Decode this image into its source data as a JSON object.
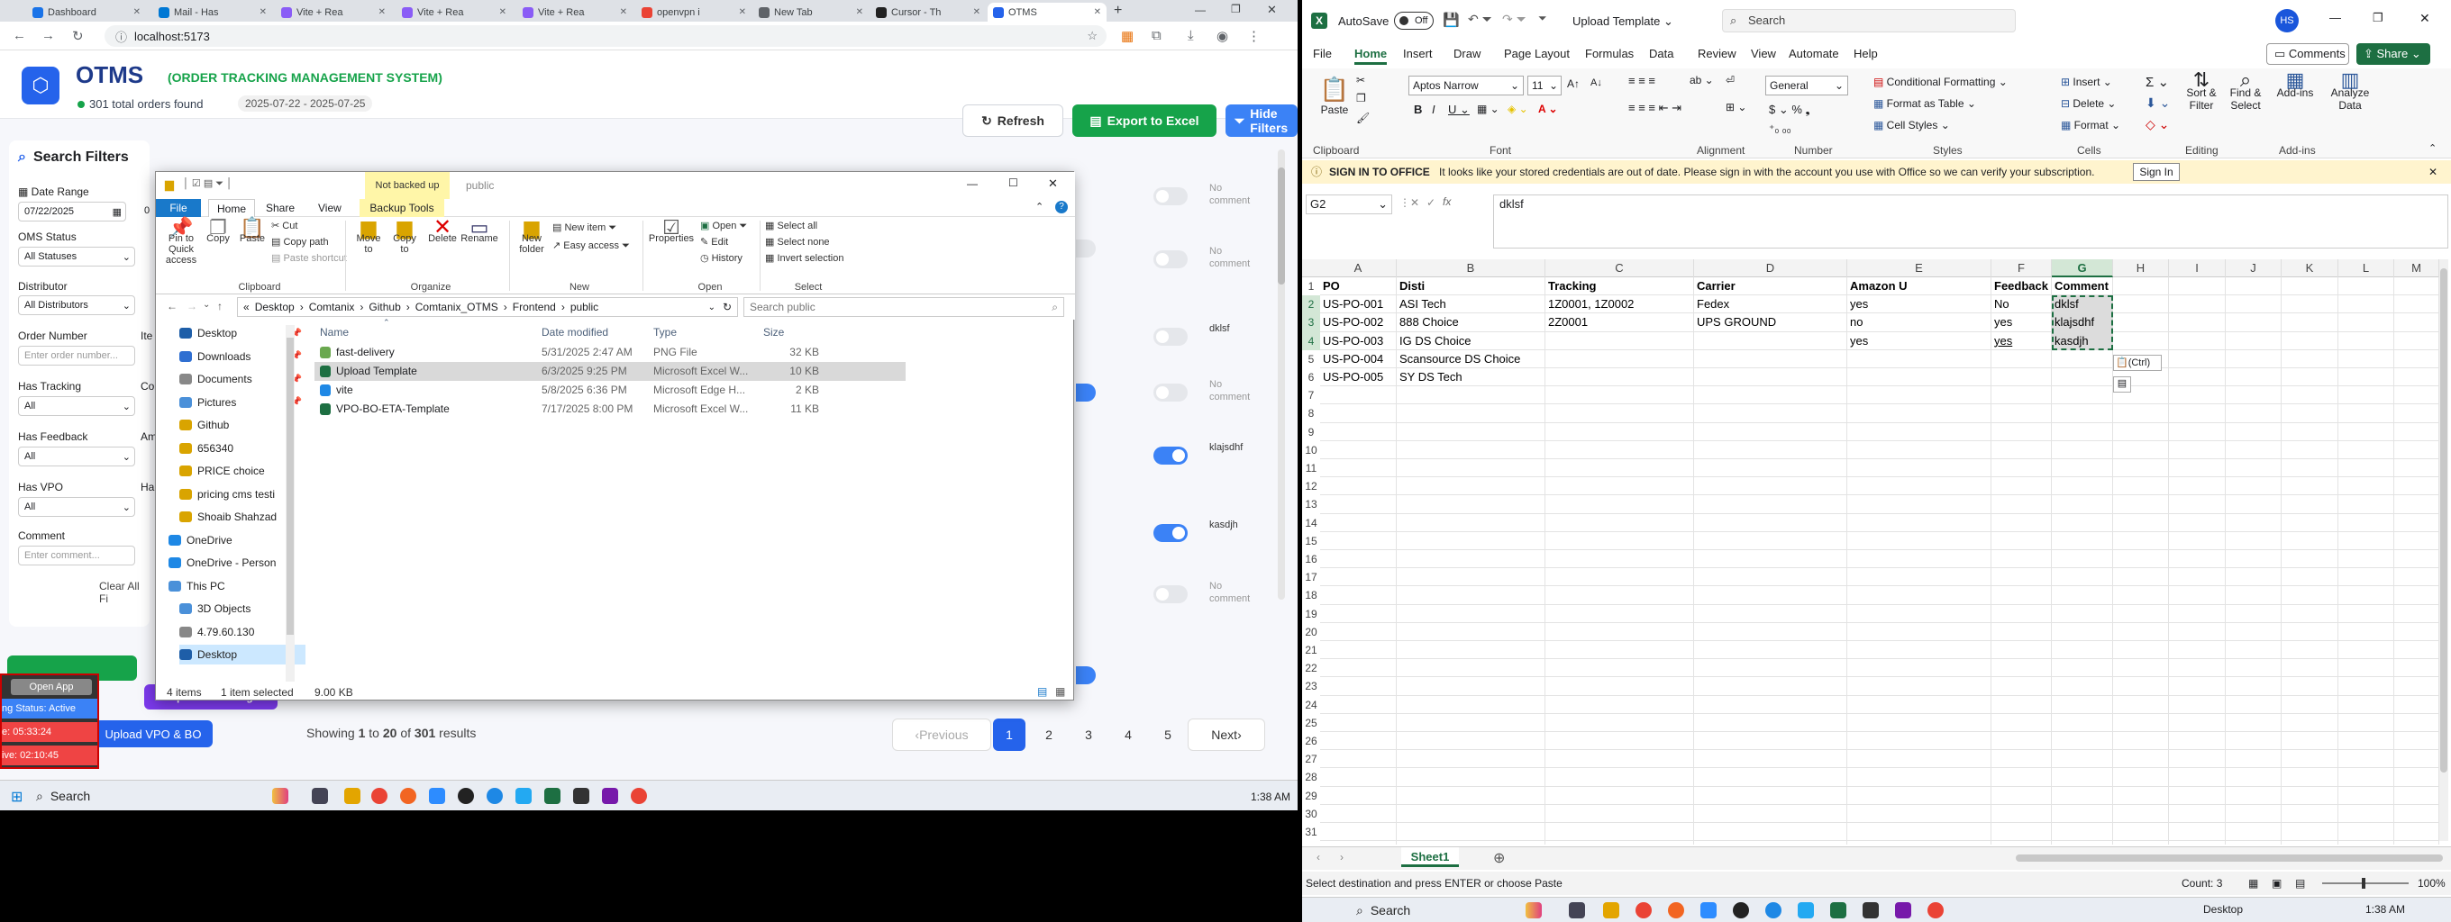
{
  "browser": {
    "tabs": [
      "Dashboard",
      "Mail - Has",
      "Vite + Rea",
      "Vite + Rea",
      "Vite + Rea",
      "openvpn i",
      "New Tab",
      "Cursor - Th",
      "OTMS"
    ],
    "url": "localhost:5173"
  },
  "otms": {
    "title": "OTMS",
    "subtitle": "(ORDER TRACKING MANAGEMENT SYSTEM)",
    "total": "301 total orders found",
    "date_range": "2025-07-22 - 2025-07-25",
    "refresh": "Refresh",
    "export": "Export to Excel",
    "hide": "Hide Filters",
    "filters_title": "Search Filters",
    "date_label": "Date Range",
    "date_value": "07/22/2025",
    "date_value2": "0",
    "status_label": "OMS Status",
    "status_value": "All Statuses",
    "dist_label": "Distributor",
    "dist_value": "All Distributors",
    "order_label": "Order Number",
    "order_ph": "Enter order number...",
    "iter_label": "Ite",
    "track_label": "Has Tracking",
    "track_value": "All",
    "co_label": "Co",
    "feedback_label": "Has Feedback",
    "feedback_value": "All",
    "am_label": "Am",
    "vpo_label": "Has VPO",
    "vpo_value": "All",
    "ha_label": "Ha",
    "comment_label": "Comment",
    "comment_ph": "Enter comment...",
    "clear": "Clear All Fi",
    "open_app": "Open App",
    "upload_tracking": "Upload Tracking",
    "upload_vpo": "Upload VPO & BO",
    "status_active": "ng Status: Active",
    "timer1": "e: 05:33:24",
    "timer2": "ive: 02:10:45",
    "rows": [
      {
        "on": false,
        "comment": "No comment"
      },
      {
        "on": false,
        "comment": "No comment"
      },
      {
        "on": false,
        "comment": "dklsf"
      },
      {
        "on": false,
        "comment": "No comment"
      },
      {
        "on": true,
        "comment": "klajsdhf"
      },
      {
        "on": true,
        "comment": "kasdjh"
      },
      {
        "on": false,
        "comment": "No comment"
      }
    ],
    "showing_pre": "Showing",
    "showing_from": "1",
    "showing_to_word": "to",
    "showing_to": "20",
    "showing_of": "of",
    "showing_total": "301",
    "showing_suffix": "results",
    "prev": "Previous",
    "next": "Next",
    "pages": [
      "1",
      "2",
      "3",
      "4",
      "5"
    ]
  },
  "explorer": {
    "title": "public",
    "backup_badge": "Not backed up",
    "tabs": [
      "File",
      "Home",
      "Share",
      "View",
      "Backup Tools"
    ],
    "ribbon": {
      "pin": "Pin to Quick access",
      "copy": "Copy",
      "paste": "Paste",
      "cut": "Cut",
      "copy_path": "Copy path",
      "paste_shortcut": "Paste shortcut",
      "move_to": "Move to",
      "copy_to": "Copy to",
      "delete": "Delete",
      "rename": "Rename",
      "new_folder": "New folder",
      "new_item": "New item",
      "easy_access": "Easy access",
      "properties": "Properties",
      "open": "Open",
      "edit": "Edit",
      "history": "History",
      "select_all": "Select all",
      "select_none": "Select none",
      "invert": "Invert selection",
      "grp_clipboard": "Clipboard",
      "grp_organize": "Organize",
      "grp_new": "New",
      "grp_open": "Open",
      "grp_select": "Select"
    },
    "breadcrumb": [
      "Desktop",
      "Comtanix",
      "Github",
      "Comtanix_OTMS",
      "Frontend",
      "public"
    ],
    "search_ph": "Search public",
    "tree": [
      "Desktop",
      "Downloads",
      "Documents",
      "Pictures",
      "Github",
      "656340",
      "PRICE choice",
      "pricing cms testi",
      "Shoaib Shahzad",
      "OneDrive",
      "OneDrive - Person",
      "This PC",
      "3D Objects",
      "4.79.60.130",
      "Desktop"
    ],
    "cols": [
      "Name",
      "Date modified",
      "Type",
      "Size"
    ],
    "files": [
      {
        "name": "fast-delivery",
        "date": "5/31/2025 2:47 AM",
        "type": "PNG File",
        "size": "32 KB"
      },
      {
        "name": "Upload Template",
        "date": "6/3/2025 9:25 PM",
        "type": "Microsoft Excel W...",
        "size": "10 KB"
      },
      {
        "name": "vite",
        "date": "5/8/2025 6:36 PM",
        "type": "Microsoft Edge H...",
        "size": "2 KB"
      },
      {
        "name": "VPO-BO-ETA-Template",
        "date": "7/17/2025 8:00 PM",
        "type": "Microsoft Excel W...",
        "size": "11 KB"
      }
    ],
    "status_items": "4 items",
    "status_sel": "1 item selected",
    "status_size": "9.00 KB"
  },
  "excel": {
    "autosave": "AutoSave",
    "off": "Off",
    "doc": "Upload Template",
    "search": "Search",
    "avatar": "HS",
    "tabs": [
      "File",
      "Home",
      "Insert",
      "Draw",
      "Page Layout",
      "Formulas",
      "Data",
      "Review",
      "View",
      "Automate",
      "Help"
    ],
    "comments": "Comments",
    "share": "Share",
    "font": "Aptos Narrow",
    "size": "11",
    "numfmt": "General",
    "cond": "Conditional Formatting",
    "fmt_table": "Format as Table",
    "cell_styles": "Cell Styles",
    "insert": "Insert",
    "delete": "Delete",
    "format": "Format",
    "sort": "Sort & Filter",
    "find": "Find & Select",
    "addins": "Add-ins",
    "analyze": "Analyze Data",
    "paste": "Paste",
    "groups": [
      "Clipboard",
      "Font",
      "Alignment",
      "Number",
      "Styles",
      "Cells",
      "Editing",
      "Add-ins"
    ],
    "msg_title": "SIGN IN TO OFFICE",
    "msg": "It looks like your stored credentials are out of date. Please sign in with the account you use with Office so we can verify your subscription.",
    "signin": "Sign In",
    "namebox": "G2",
    "formula": "dklsf",
    "cols": [
      "A",
      "B",
      "C",
      "D",
      "E",
      "F",
      "G",
      "H",
      "I",
      "J",
      "K",
      "L",
      "M"
    ],
    "rows": [
      [
        "PO",
        "Disti",
        "Tracking",
        "Carrier",
        "Amazon U",
        "Feedback",
        "Comment"
      ],
      [
        "US-PO-001",
        "ASI Tech",
        "1Z0001, 1Z0002",
        "Fedex",
        "yes",
        "No",
        "dklsf"
      ],
      [
        "US-PO-002",
        "888 Choice",
        "2Z0001",
        "UPS GROUND",
        "no",
        "yes",
        "klajsdhf"
      ],
      [
        "US-PO-003",
        "IG DS Choice",
        "",
        "",
        "yes",
        "yes",
        "kasdjh"
      ],
      [
        "US-PO-004",
        "Scansource DS Choice",
        "",
        "",
        "",
        "",
        ""
      ],
      [
        "US-PO-005",
        "SY DS Tech",
        "",
        "",
        "",
        "",
        ""
      ]
    ],
    "paste_tag": "(Ctrl)",
    "sheet": "Sheet1",
    "status": "Select destination and press ENTER or choose Paste",
    "count": "Count: 3",
    "zoom": "100%"
  },
  "taskbar": {
    "search": "Search",
    "time": "1:38 AM",
    "desktop": "Desktop"
  }
}
